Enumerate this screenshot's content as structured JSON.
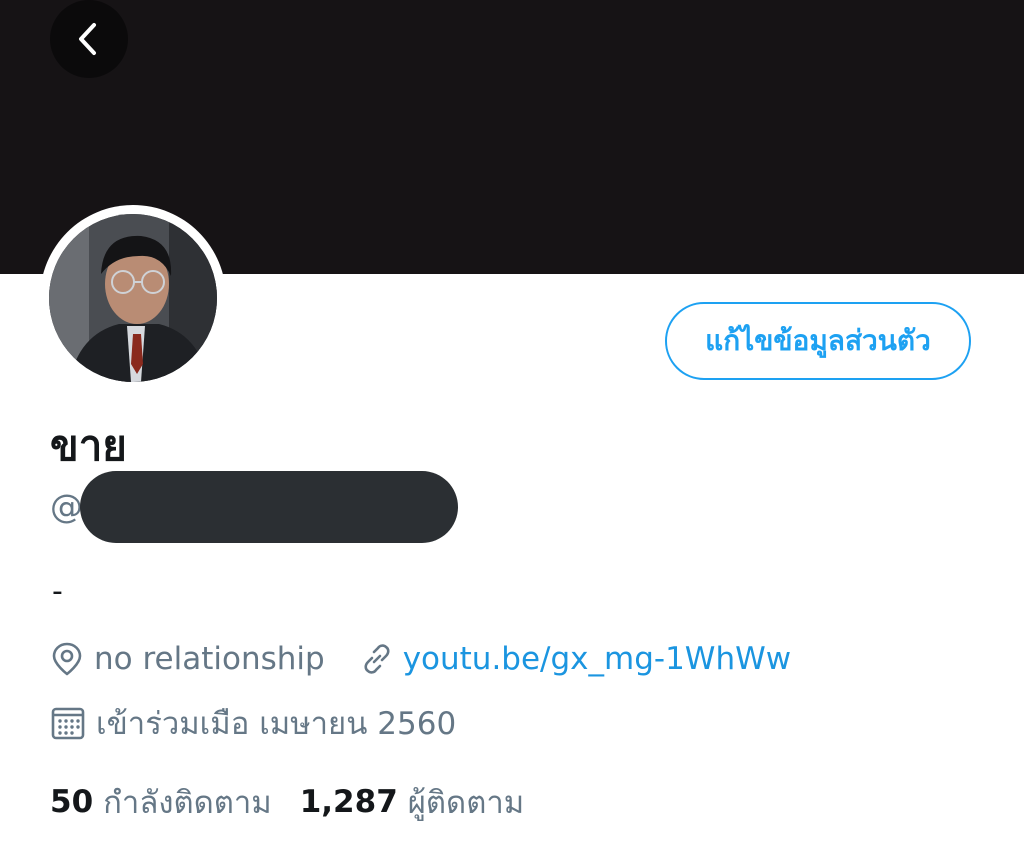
{
  "header": {
    "banner_color": "#161315",
    "back_icon": "chevron-left-icon"
  },
  "profile": {
    "avatar_icon": "profile-photo",
    "edit_profile_label": "แก้ไขข้อมูลส่วนตัว",
    "display_name": "ขาย",
    "handle_prefix": "@",
    "bio": "-",
    "location": "no relationship",
    "location_icon": "location-pin-icon",
    "website": "youtu.be/gx_mg-1WhWw",
    "website_icon": "link-icon",
    "joined": "เข้าร่วมเมือ เมษายน 2560",
    "joined_icon": "calendar-icon"
  },
  "stats": {
    "following_count": "50",
    "following_label": "กำลังติดตาม",
    "followers_count": "1,287",
    "followers_label": "ผู้ติดตาม"
  },
  "colors": {
    "accent": "#1da1f2",
    "link": "#1b95e0",
    "secondary_text": "#657786",
    "primary_text": "#14171a"
  }
}
